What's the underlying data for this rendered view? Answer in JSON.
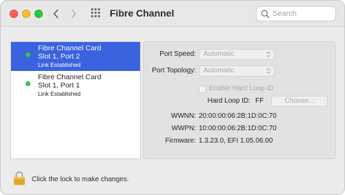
{
  "window": {
    "title": "Fibre Channel",
    "controls": [
      "close-button",
      "minimize-button",
      "zoom-button"
    ]
  },
  "toolbar": {
    "back_icon": "chevron-left-icon",
    "forward_icon": "chevron-right-icon",
    "grid_icon": "show-all-grid-icon"
  },
  "search": {
    "placeholder": "Search",
    "value": ""
  },
  "ports": [
    {
      "line1": "Fibre Channel Card",
      "line2": "Slot 1, Port 2",
      "status": "Link Established",
      "selected": true
    },
    {
      "line1": "Fibre Channel Card",
      "line2": "Slot 1, Port 1",
      "status": "Link Established",
      "selected": false
    }
  ],
  "settings": {
    "port_speed_label": "Port Speed:",
    "port_speed_value": "Automatic",
    "port_topology_label": "Port Topology:",
    "port_topology_value": "Automatic",
    "hard_loop_checkbox_label": "Enable Hard Loop ID",
    "hard_loop_checked": false,
    "hard_loop_id_label": "Hard Loop ID:",
    "hard_loop_id_value": "FF",
    "choose_button_label": "Choose...",
    "wwnn_label": "WWNN:",
    "wwnn_value": "20:00:00:06:2B:1D:0C:70",
    "wwpn_label": "WWPN:",
    "wwpn_value": "10:00:00:06:2B:1D:0C:70",
    "firmware_label": "Firmware:",
    "firmware_value": "1.3.23.0, EFI 1.05.06.00"
  },
  "footer": {
    "lock_text": "Click the lock to make changes."
  },
  "colors": {
    "selection": "#3b63de",
    "status_green": "#39c14b",
    "lock_gold": "#e3a52a"
  }
}
